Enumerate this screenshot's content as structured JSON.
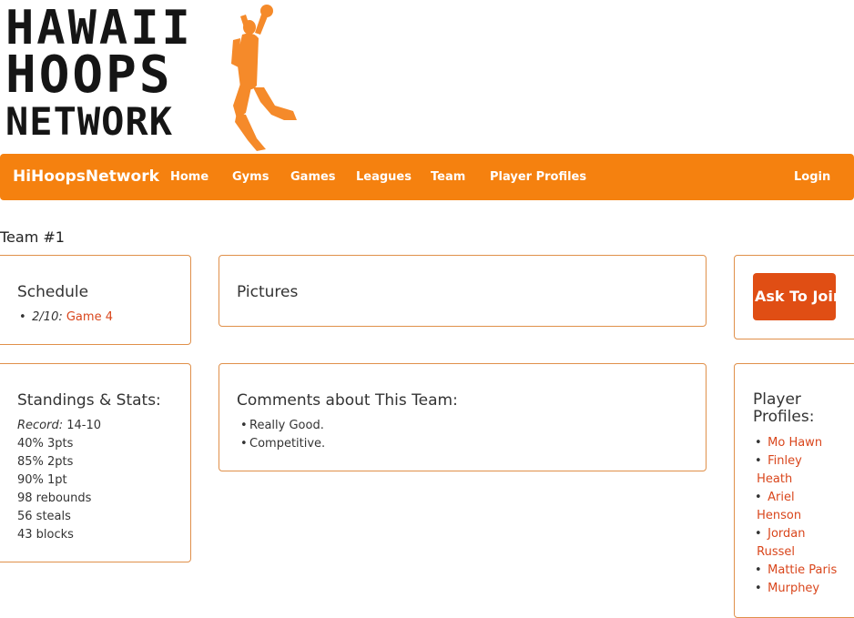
{
  "logo": {
    "line1": "HAWAII",
    "line2": "HOOPS",
    "line3": "NETWORK"
  },
  "navbar": {
    "brand": "HiHoopsNetwork",
    "items": [
      "Home",
      "Gyms",
      "Games",
      "Leagues",
      "Team",
      "Player Profiles"
    ],
    "login": "Login"
  },
  "team": {
    "title": "Team #1"
  },
  "schedule": {
    "heading": "Schedule",
    "items": [
      {
        "date": "2/10:",
        "game": "Game 4"
      }
    ]
  },
  "pictures": {
    "heading": "Pictures"
  },
  "join": {
    "label": "Ask To Join"
  },
  "standings": {
    "heading": "Standings & Stats:",
    "record_label": "Record:",
    "record_value": "14-10",
    "stats": [
      "40% 3pts",
      "85% 2pts",
      "90% 1pt",
      "98 rebounds",
      "56 steals",
      "43 blocks"
    ]
  },
  "comments": {
    "heading": "Comments about This Team:",
    "items": [
      "Really Good.",
      "Competitive."
    ]
  },
  "players": {
    "heading_line1": "Player",
    "heading_line2": "Profiles:",
    "items": [
      {
        "first": "Mo Hawn",
        "second": ""
      },
      {
        "first": "Finley",
        "second": "Heath"
      },
      {
        "first": "Ariel",
        "second": "Henson"
      },
      {
        "first": "Jordan",
        "second": "Russel"
      },
      {
        "first": "Mattie Paris",
        "second": ""
      },
      {
        "first": "Murphey",
        "second": ""
      }
    ]
  },
  "colors": {
    "navbar": "#f5810f",
    "link": "#d9461c",
    "button": "#e04e14",
    "panel_border": "#e0904a"
  }
}
